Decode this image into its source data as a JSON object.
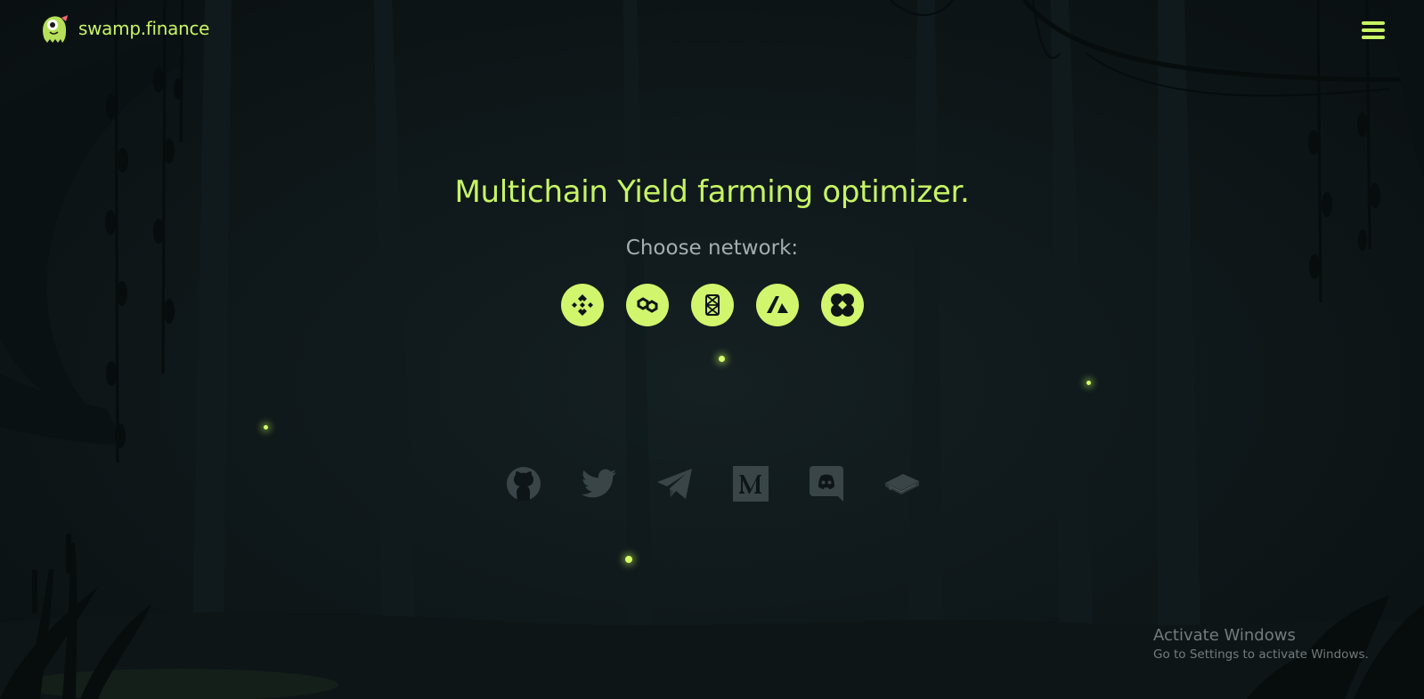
{
  "header": {
    "brand_name": "swamp.finance",
    "menu_icon": "hamburger-menu-icon"
  },
  "hero": {
    "headline": "Multichain Yield farming optimizer.",
    "network_prompt": "Choose network:"
  },
  "networks": [
    {
      "name": "BNB Chain",
      "icon": "bnb-icon"
    },
    {
      "name": "Polygon",
      "icon": "polygon-icon"
    },
    {
      "name": "Fantom",
      "icon": "fantom-icon"
    },
    {
      "name": "Avalanche",
      "icon": "avalanche-icon"
    },
    {
      "name": "Cronos",
      "icon": "clover-icon"
    }
  ],
  "socials": [
    {
      "name": "GitHub",
      "icon": "github-icon"
    },
    {
      "name": "Twitter",
      "icon": "twitter-icon"
    },
    {
      "name": "Telegram",
      "icon": "telegram-icon"
    },
    {
      "name": "Medium",
      "icon": "medium-icon"
    },
    {
      "name": "Discord",
      "icon": "discord-icon"
    },
    {
      "name": "Docs",
      "icon": "docs-book-icon"
    }
  ],
  "windows_watermark": {
    "title": "Activate Windows",
    "subtitle": "Go to Settings to activate Windows."
  },
  "colors": {
    "accent": "#c7f464",
    "background": "#0c1315",
    "muted_text": "#a4aeb1",
    "social_icon": "#3a4548"
  }
}
